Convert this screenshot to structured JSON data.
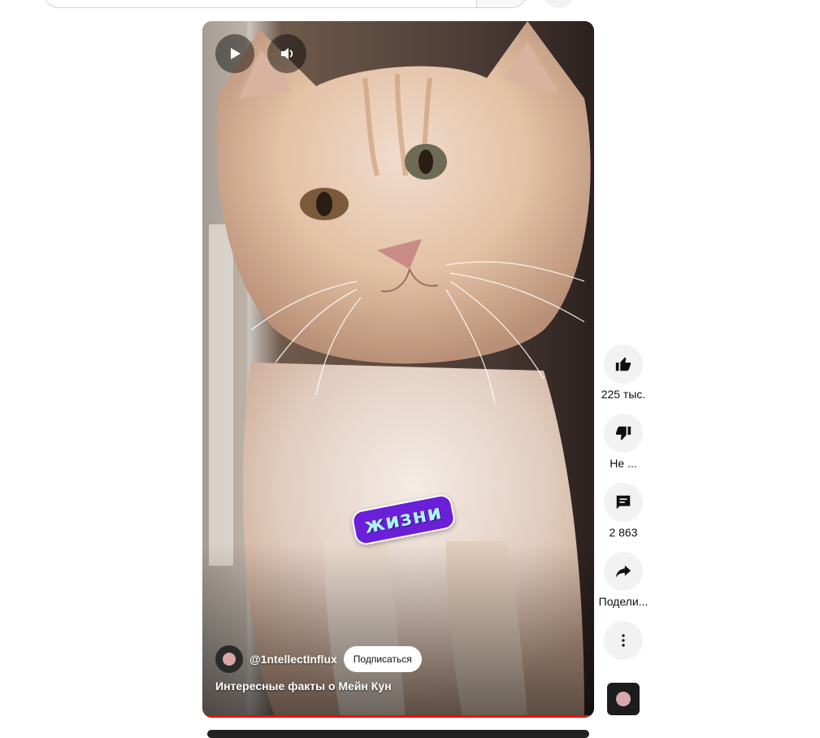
{
  "video": {
    "channel_handle": "@1ntellectInflux",
    "subscribe_label": "Подписаться",
    "title": "Интересные факты о Мейн Кун",
    "sticker_text": "жизни",
    "progress_percent": 98
  },
  "actions": {
    "like_count": "225 тыс.",
    "dislike_label": "Не ...",
    "comment_count": "2 863",
    "share_label": "Подели..."
  },
  "colors": {
    "progress": "#ff0000",
    "sticker_bg": "#6b1fd9",
    "sticker_text": "#aef3ff"
  },
  "icons": {
    "play": "play-icon",
    "volume": "volume-icon",
    "like": "thumbs-up-icon",
    "dislike": "thumbs-down-icon",
    "comments": "comment-icon",
    "share": "share-icon",
    "more": "more-vert-icon"
  }
}
